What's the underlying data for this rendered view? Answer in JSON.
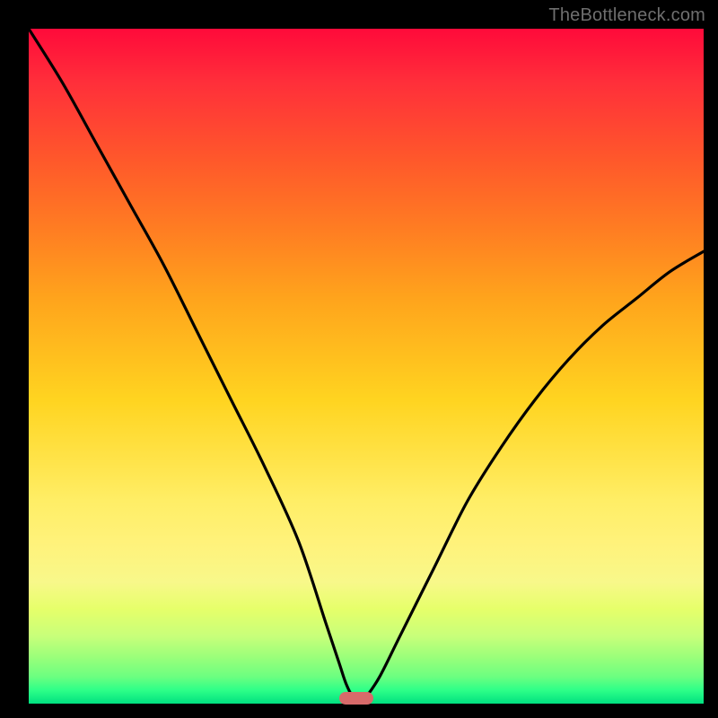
{
  "watermark": "TheBottleneck.com",
  "chart_data": {
    "type": "line",
    "title": "",
    "xlabel": "",
    "ylabel": "",
    "xlim": [
      0,
      100
    ],
    "ylim": [
      0,
      100
    ],
    "grid": false,
    "legend": false,
    "series": [
      {
        "name": "bottleneck-curve",
        "x": [
          0,
          5,
          10,
          15,
          20,
          25,
          30,
          35,
          40,
          44,
          46,
          47,
          48,
          49,
          50,
          52,
          55,
          60,
          65,
          70,
          75,
          80,
          85,
          90,
          95,
          100
        ],
        "y": [
          100,
          92,
          83,
          74,
          65,
          55,
          45,
          35,
          24,
          12,
          6,
          3,
          1,
          0,
          1,
          4,
          10,
          20,
          30,
          38,
          45,
          51,
          56,
          60,
          64,
          67
        ]
      }
    ],
    "marker": {
      "x": 48.5,
      "y": 0.8,
      "color": "#d86a6a"
    },
    "background_gradient": {
      "top_color": "#ff0a3a",
      "bottom_color": "#00e080"
    }
  }
}
